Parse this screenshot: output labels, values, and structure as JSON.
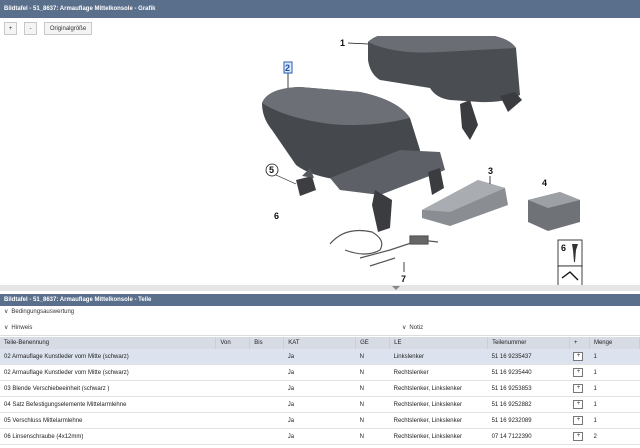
{
  "header": {
    "title": "Bildtafel - 51_8637: Armauflage Mittelkonsole - Grafik"
  },
  "toolbar": {
    "zoom_in": "+",
    "zoom_out": "-",
    "original_size": "Originalgröße"
  },
  "graphic": {
    "callouts": [
      "1",
      "2",
      "3",
      "4",
      "5",
      "6",
      "6",
      "7"
    ],
    "highlighted": "2"
  },
  "parts_panel": {
    "title": "Bildtafel - 51_8637: Armauflage Mittelkonsole - Teile",
    "conditions": "Bedingungsauswertung",
    "hint": "Hinweis",
    "note": "Notiz"
  },
  "table": {
    "columns": [
      "Teile-Benennung",
      "Von",
      "Bis",
      "KAT",
      "GE",
      "LE",
      "Teilenummer",
      "+",
      "Menge"
    ],
    "rows": [
      [
        "02 Armauflage Kunstleder vorn Mitte (schwarz)",
        "",
        "",
        "Ja",
        "N",
        "Linkslenker",
        "51 16 9235437",
        "",
        "1"
      ],
      [
        "02 Armauflage Kunstleder vorn Mitte (schwarz)",
        "",
        "",
        "Ja",
        "N",
        "Rechtslenker",
        "51 16 9235440",
        "",
        "1"
      ],
      [
        "03 Blende Verschiebeeinheit (schwarz )",
        "",
        "",
        "Ja",
        "N",
        "Rechtslenker, Linkslenker",
        "51 16 9253853",
        "",
        "1"
      ],
      [
        "04 Satz Befestigungselemente Mittelarmlehne",
        "",
        "",
        "Ja",
        "N",
        "Rechtslenker, Linkslenker",
        "51 16 9252882",
        "",
        "1"
      ],
      [
        "05 Verschluss Mittelarmlehne",
        "",
        "",
        "Ja",
        "N",
        "Rechtslenker, Linkslenker",
        "51 16 9232089",
        "",
        "1"
      ],
      [
        "06 Linsenschraube (4x12mm)",
        "",
        "",
        "Ja",
        "N",
        "Rechtslenker, Linkslenker",
        "07 14 7122390",
        "",
        "2"
      ]
    ]
  }
}
